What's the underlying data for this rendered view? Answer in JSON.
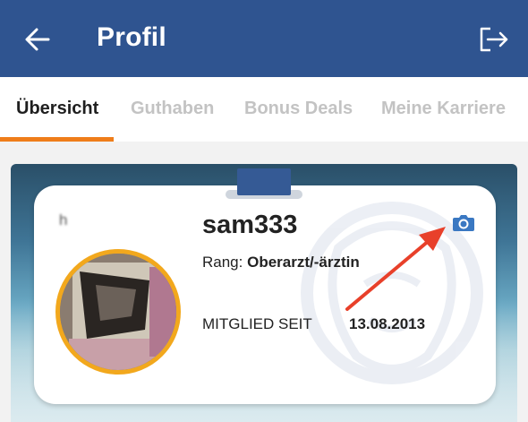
{
  "header": {
    "title": "Profil",
    "back_icon": "arrow-left-icon",
    "logout_icon": "logout-icon",
    "background_color": "#2f5490"
  },
  "tabs": [
    {
      "label": "Übersicht",
      "active": true
    },
    {
      "label": "Guthaben",
      "active": false
    },
    {
      "label": "Bonus Deals",
      "active": false
    },
    {
      "label": "Meine Karriere",
      "active": false
    }
  ],
  "tab_accent_color": "#ef7d1a",
  "profile": {
    "blurred_text": "h",
    "username": "sam333",
    "rank_label": "Rang:",
    "rank_value": "Oberarzt/-ärztin",
    "member_since_label": "MITGLIED SEIT",
    "member_since_date": "13.08.2013",
    "camera_icon": "camera-icon",
    "avatar_border_color": "#f2a81d"
  },
  "annotation": {
    "arrow_color": "#e8402a"
  }
}
